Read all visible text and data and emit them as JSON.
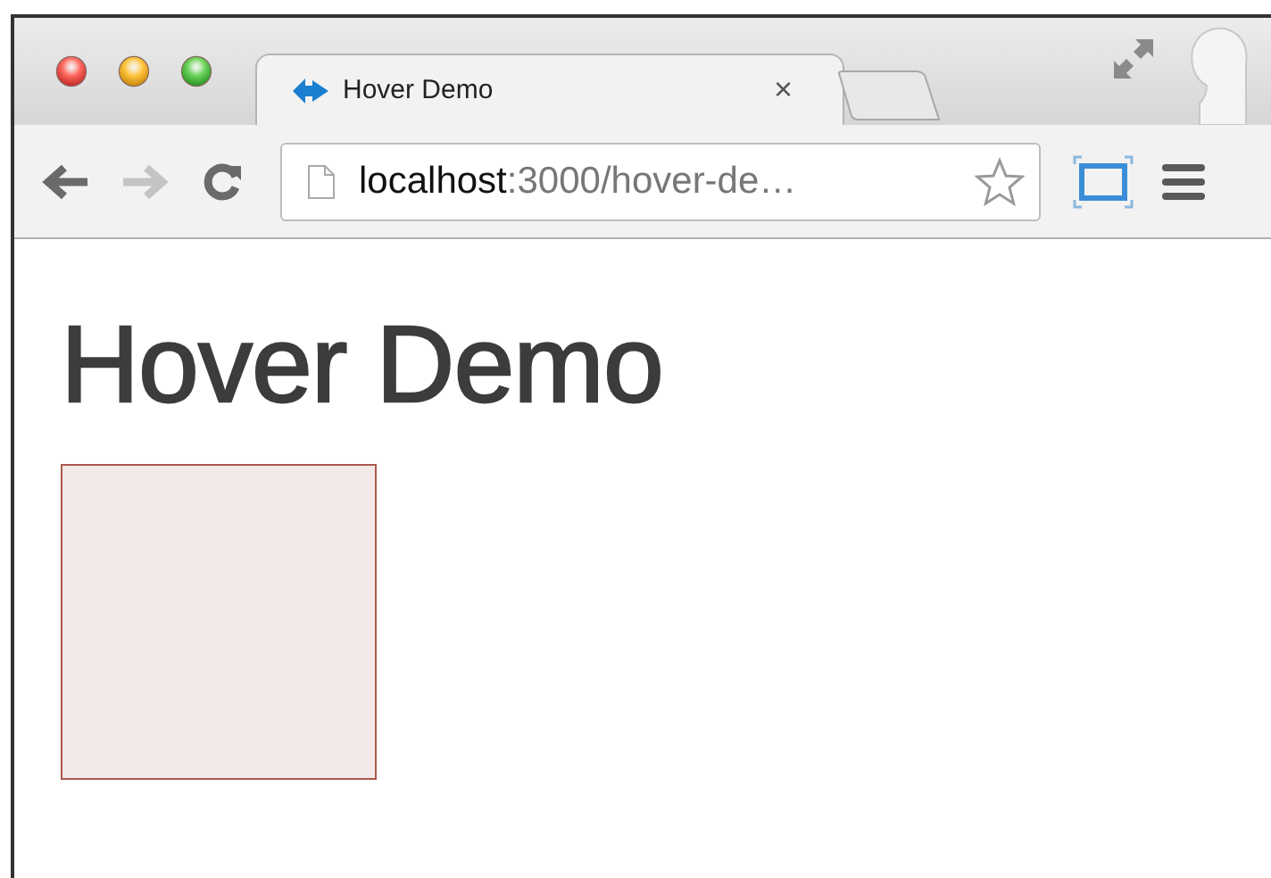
{
  "window": {
    "buttons": [
      {
        "kind": "close"
      },
      {
        "kind": "minimize"
      },
      {
        "kind": "zoom"
      }
    ]
  },
  "tabs": [
    {
      "title": "Hover Demo",
      "close": "×",
      "selected": true
    }
  ],
  "toolbar": {
    "nav": [
      {
        "kind": "back",
        "disabled": false
      },
      {
        "kind": "forward",
        "disabled": true
      }
    ]
  },
  "address": {
    "host": "localhost",
    "path": ":3000/hover-de…"
  },
  "page": {
    "heading": "Hover Demo"
  }
}
